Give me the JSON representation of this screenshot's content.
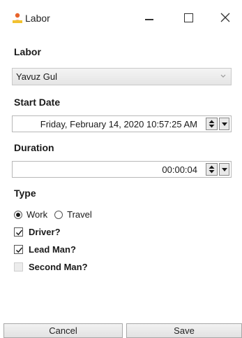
{
  "window": {
    "title": "Labor",
    "icon": "person-app-icon"
  },
  "labor": {
    "label": "Labor",
    "value": "Yavuz Gul"
  },
  "start_date": {
    "label": "Start Date",
    "value": "Friday, February 14, 2020 10:57:25 AM"
  },
  "duration": {
    "label": "Duration",
    "value": "00:00:04"
  },
  "type": {
    "label": "Type",
    "options": [
      {
        "label": "Work",
        "selected": true
      },
      {
        "label": "Travel",
        "selected": false
      }
    ]
  },
  "checks": [
    {
      "label": "Driver?",
      "checked": true
    },
    {
      "label": "Lead Man?",
      "checked": true
    },
    {
      "label": "Second Man?",
      "checked": false
    }
  ],
  "buttons": {
    "cancel": "Cancel",
    "save": "Save"
  }
}
